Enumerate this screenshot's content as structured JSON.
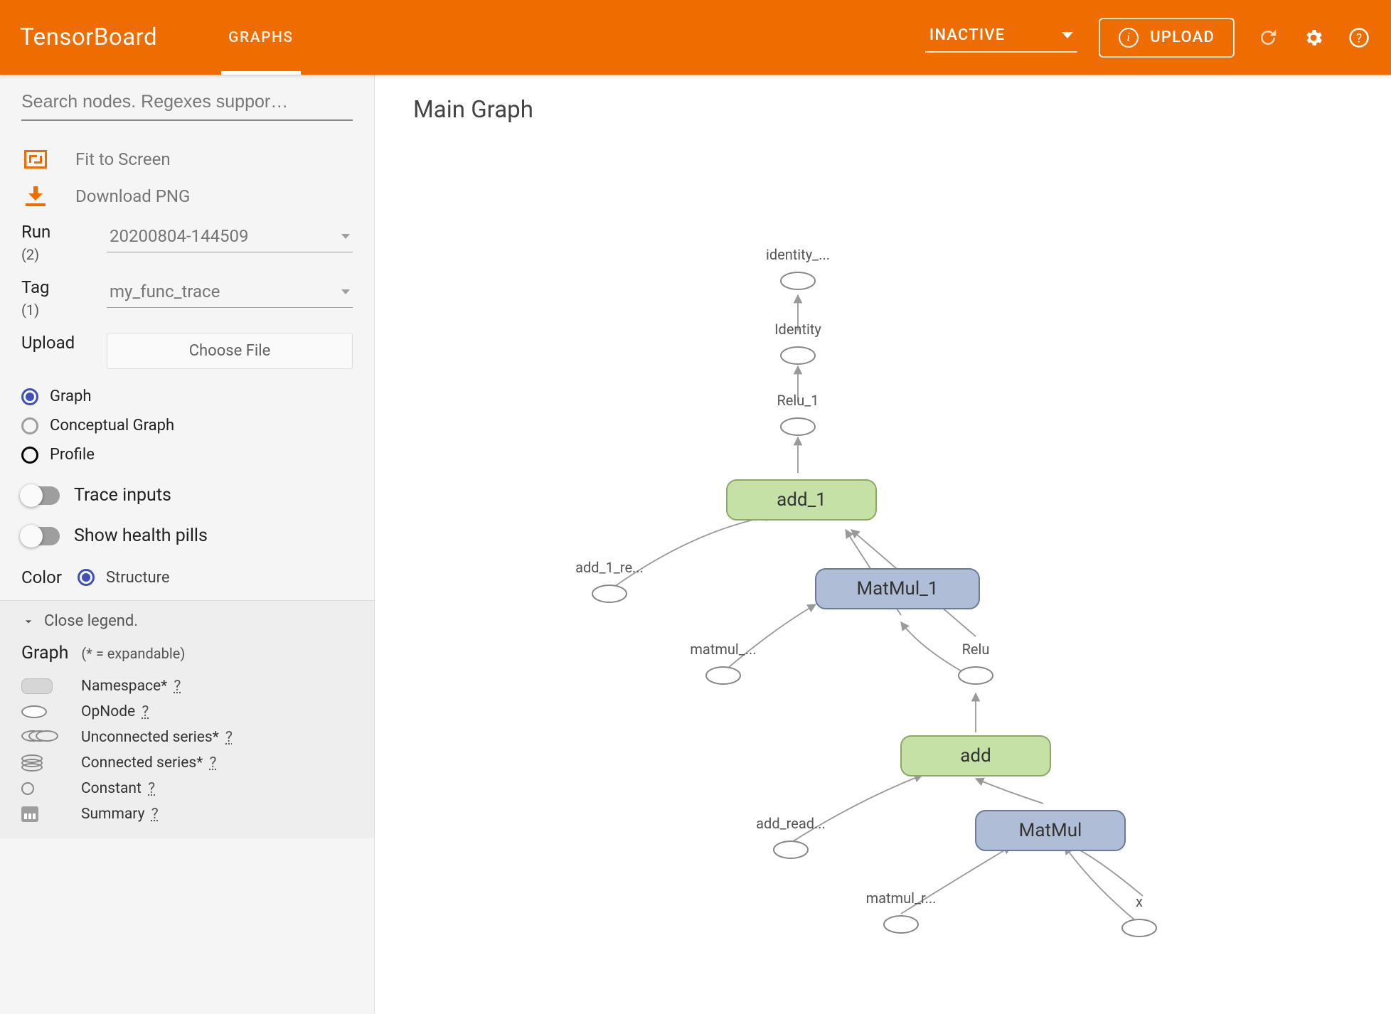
{
  "header": {
    "brand": "TensorBoard",
    "tab_graphs": "GRAPHS",
    "inactive_label": "INACTIVE",
    "upload_label": "UPLOAD"
  },
  "sidebar": {
    "search_placeholder": "Search nodes. Regexes suppor…",
    "fit_to_screen": "Fit to Screen",
    "download_png": "Download PNG",
    "run_label": "Run",
    "run_count": "(2)",
    "run_value": "20200804-144509",
    "tag_label": "Tag",
    "tag_count": "(1)",
    "tag_value": "my_func_trace",
    "upload_label": "Upload",
    "choose_file": "Choose File",
    "radio_graph": "Graph",
    "radio_conceptual": "Conceptual Graph",
    "radio_profile": "Profile",
    "trace_inputs": "Trace inputs",
    "health_pills": "Show health pills",
    "color_label": "Color",
    "color_value": "Structure",
    "legend": {
      "close": "Close legend.",
      "title": "Graph",
      "sub": "(* = expandable)",
      "namespace": "Namespace*",
      "opnode": "OpNode",
      "unconnected": "Unconnected series*",
      "connected": "Connected series*",
      "constant": "Constant",
      "summary": "Summary",
      "q": "?"
    }
  },
  "graph": {
    "title": "Main Graph",
    "nodes": {
      "identity_ret": "identity_...",
      "identity": "Identity",
      "relu1": "Relu_1",
      "add1": "add_1",
      "matmul1": "MatMul_1",
      "add1_read": "add_1_re...",
      "matmul_": "matmul_...",
      "relu": "Relu",
      "add": "add",
      "matmul": "MatMul",
      "add_read": "add_read...",
      "matmul_r": "matmul_r...",
      "x": "x"
    }
  }
}
